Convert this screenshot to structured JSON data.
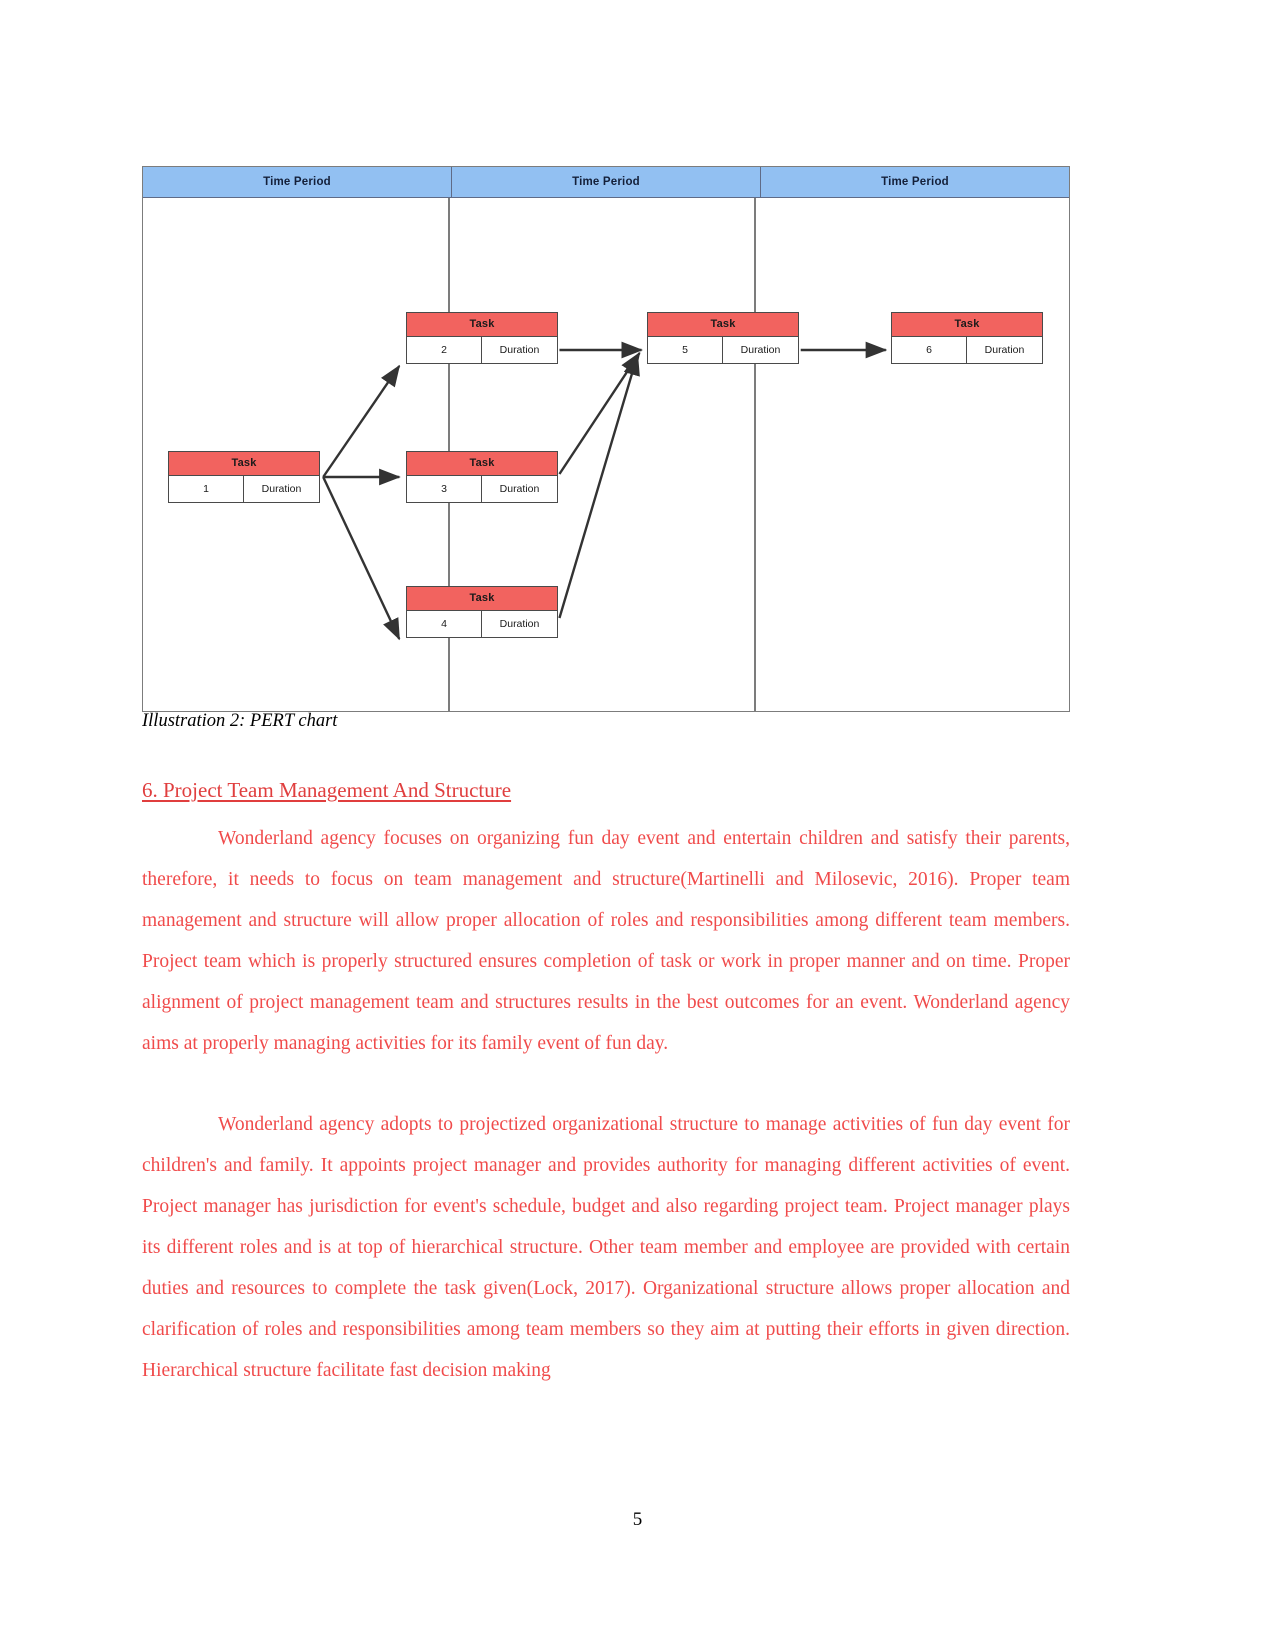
{
  "figure": {
    "caption": "Illustration 2: PERT chart",
    "header_cells": [
      "Time Period",
      "Time Period",
      "Time Period"
    ],
    "colors": {
      "period_fill": "#92c0f2",
      "period_border": "#5f6b87",
      "task_header_fill": "#f2635f",
      "node_border": "#4a4a4a",
      "frame_border": "#7c7c7c",
      "arrow": "#333333"
    },
    "chart_data": {
      "type": "diagram",
      "diagram_kind": "pert-network",
      "title": "PERT chart",
      "lanes": [
        "Time Period",
        "Time Period",
        "Time Period"
      ],
      "nodes": [
        {
          "id": "1",
          "title": "Task",
          "number": "1",
          "duration": "Duration",
          "lane": 1
        },
        {
          "id": "2",
          "title": "Task",
          "number": "2",
          "duration": "Duration",
          "lane": 2
        },
        {
          "id": "3",
          "title": "Task",
          "number": "3",
          "duration": "Duration",
          "lane": 2
        },
        {
          "id": "4",
          "title": "Task",
          "number": "4",
          "duration": "Duration",
          "lane": 2
        },
        {
          "id": "5",
          "title": "Task",
          "number": "5",
          "duration": "Duration",
          "lane": 2
        },
        {
          "id": "6",
          "title": "Task",
          "number": "6",
          "duration": "Duration",
          "lane": 3
        }
      ],
      "edges": [
        {
          "from": "1",
          "to": "2"
        },
        {
          "from": "1",
          "to": "3"
        },
        {
          "from": "1",
          "to": "4"
        },
        {
          "from": "2",
          "to": "5"
        },
        {
          "from": "3",
          "to": "5"
        },
        {
          "from": "4",
          "to": "5"
        },
        {
          "from": "5",
          "to": "6"
        }
      ]
    }
  },
  "heading": {
    "text": "6. Project Team Management And Structure",
    "color": "#e03e3e"
  },
  "paragraphs": {
    "p1": "Wonderland agency focuses on organizing fun day event and entertain children and satisfy their parents, therefore, it needs to focus on team management and structure(Martinelli and Milosevic, 2016). Proper team management and structure will allow proper allocation of roles and responsibilities among different team members. Project team which is properly structured ensures completion of task or work in proper manner and on time. Proper alignment of project management team and structures results in the best outcomes for an event. Wonderland agency aims at properly managing activities for its family event of fun day.",
    "p2": "Wonderland agency adopts to projectized organizational structure to manage activities of fun day event for children's and family. It appoints project manager and provides authority for managing different activities of event. Project manager has jurisdiction for event's schedule, budget and also regarding project team. Project manager plays its different roles and is at top of hierarchical structure. Other team member and employee are provided with certain duties and resources to complete the task given(Lock, 2017). Organizational structure allows proper allocation and clarification of roles and responsibilities among team members so they aim at putting their efforts in given direction. Hierarchical structure facilitate fast decision making"
  },
  "footer": {
    "page_number": "5"
  }
}
